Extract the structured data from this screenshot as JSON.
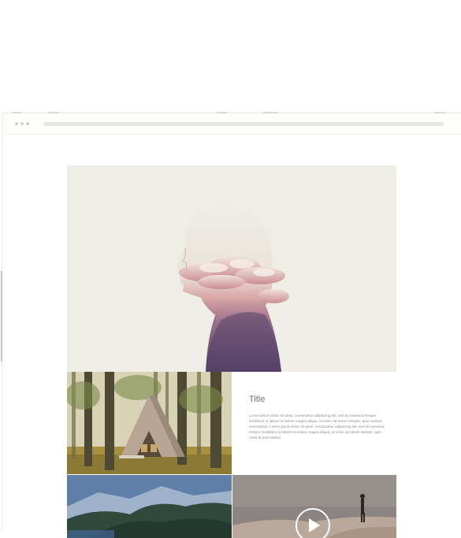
{
  "browser": {
    "controls": [
      "dot",
      "dot",
      "dot"
    ]
  },
  "hero": {
    "image": "double-exposure woman silhouette with clouds"
  },
  "gallery": {
    "tile1_image": "a-frame cabin in forest",
    "tile2_title": "Title",
    "tile2_body": "Lorem ipsum dolor sit amet, consectetur adipiscing elit, sed do eiusmod tempor incididunt ut labore et dolore magna aliqua. Ut enim ad minim veniam, quis nostrud exercitation. Lorem ipsum dolor sit amet, consectetur adipiscing elit, sed do eiusmod tempor incididunt ut labore et dolore magna aliqua. Ut enim ad minim veniam, quis nostrud exercitation.",
    "tile3_image": "forested mountain lake",
    "tile4_image": "hiker on mountain ridge",
    "tile4_icon": "play-icon"
  },
  "colors": {
    "hero_bg": "#eeeee6",
    "addressbar": "#e7e7e2",
    "accent": "#b9c9df"
  }
}
